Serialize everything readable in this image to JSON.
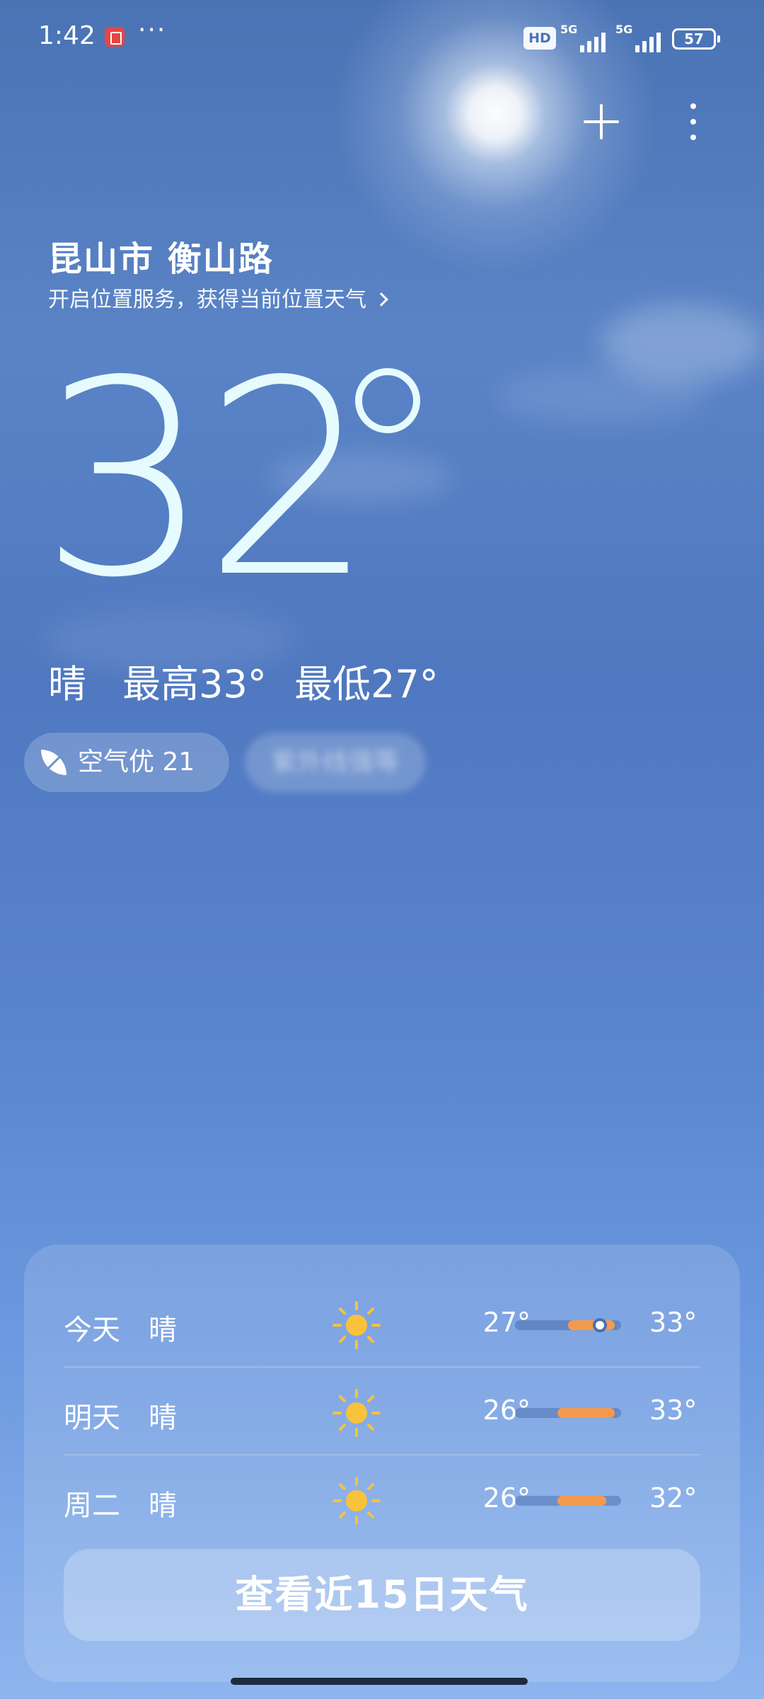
{
  "status_bar": {
    "time": "1:42",
    "more": "···",
    "hd_badge": "HD",
    "network_1": "5G",
    "network_2": "5G",
    "battery": "57"
  },
  "header": {
    "add_icon": "plus-icon",
    "menu_icon": "more-vertical-icon"
  },
  "location": {
    "name": "昆山市 衡山路",
    "service_prompt": "开启位置服务，获得当前位置天气"
  },
  "current": {
    "temp": "32",
    "condition": "晴",
    "high": "最高33°",
    "low": "最低27°"
  },
  "chips": {
    "air_quality": "空气优 21",
    "blurred": "紫外线强等"
  },
  "forecast": {
    "rows": [
      {
        "day": "今天",
        "condition": "晴",
        "icon": "sun-icon",
        "low": "27°",
        "high": "33°",
        "bar_start": 0.5,
        "bar_end": 0.94,
        "now": 0.8
      },
      {
        "day": "明天",
        "condition": "晴",
        "icon": "sun-icon",
        "low": "26°",
        "high": "33°",
        "bar_start": 0.4,
        "bar_end": 0.94
      },
      {
        "day": "周二",
        "condition": "晴",
        "icon": "sun-icon",
        "low": "26°",
        "high": "32°",
        "bar_start": 0.4,
        "bar_end": 0.86
      }
    ],
    "cta": "查看近15日天气"
  },
  "colors": {
    "accent_bar": "#f49a4e",
    "sun": "#f8c23a",
    "temp_text": "#e6fbfd"
  }
}
